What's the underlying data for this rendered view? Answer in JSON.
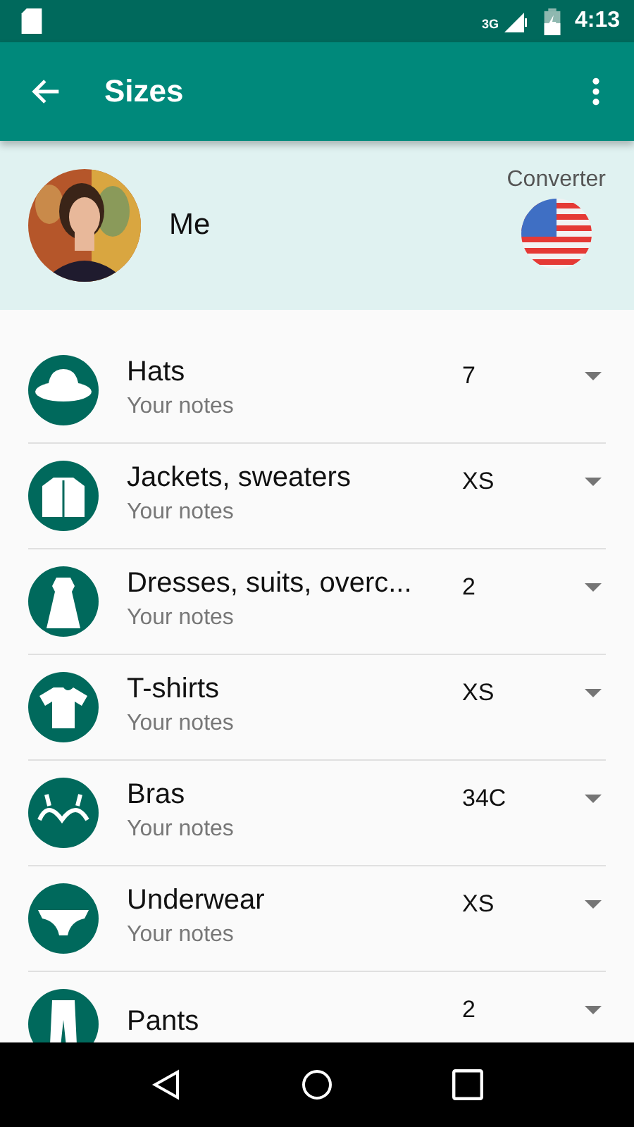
{
  "status_bar": {
    "network": "3G",
    "time": "4:13"
  },
  "toolbar": {
    "title": "Sizes"
  },
  "profile": {
    "name": "Me",
    "converter_label": "Converter"
  },
  "items": [
    {
      "kind": "hat",
      "name": "Hats",
      "notes": "Your notes",
      "size": "7"
    },
    {
      "kind": "jacket",
      "name": "Jackets, sweaters",
      "notes": "Your notes",
      "size": "XS"
    },
    {
      "kind": "dress",
      "name": "Dresses, suits, overc...",
      "notes": "Your notes",
      "size": "2"
    },
    {
      "kind": "tshirt",
      "name": "T-shirts",
      "notes": "Your notes",
      "size": "XS"
    },
    {
      "kind": "bra",
      "name": "Bras",
      "notes": "Your notes",
      "size": "34C"
    },
    {
      "kind": "underwear",
      "name": "Underwear",
      "notes": "Your notes",
      "size": "XS"
    },
    {
      "kind": "pants",
      "name": "Pants",
      "size": "2"
    }
  ]
}
